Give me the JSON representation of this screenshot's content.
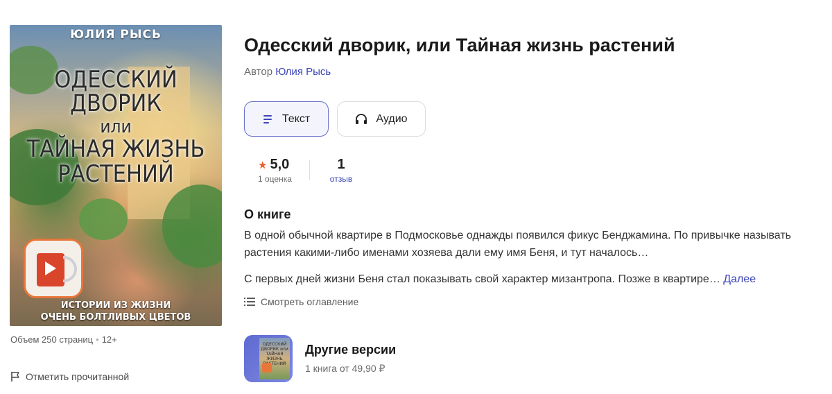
{
  "cover": {
    "author": "ЮЛИЯ РЫСЬ",
    "title_lines": [
      "ОДЕССКИЙ ДВОРИК",
      "или",
      "ТАЙНАЯ ЖИЗНЬ",
      "РАСТЕНИЙ"
    ],
    "bottom_lines": [
      "ИСТОРИИ ИЗ ЖИЗНИ",
      "ОЧЕНЬ БОЛТЛИВЫХ ЦВЕТОВ"
    ],
    "badge_icon": "audiobook-icon"
  },
  "meta": {
    "pages": "Объем 250 страниц",
    "age": "12+"
  },
  "mark_read_label": "Отметить прочитанной",
  "book": {
    "title": "Одесский дворик, или Тайная жизнь растений",
    "author_prefix": "Автор",
    "author_name": "Юлия Рысь"
  },
  "formats": {
    "text_label": "Текст",
    "audio_label": "Аудио",
    "selected": "Текст"
  },
  "rating": {
    "value": "5,0",
    "count_label": "1 оценка"
  },
  "reviews": {
    "value": "1",
    "label": "отзыв"
  },
  "about": {
    "heading": "О книге",
    "paragraph1": "В одной обычной квартире в Подмосковье однажды появился фикус Бенджамина. По привычке называть растения какими-либо именами хозяева дали ему имя Беня, и тут началось…",
    "paragraph2": "С первых дней жизни Беня стал показывать свой характер мизантропа. Позже в квартире…",
    "more_link": "Далее",
    "toc_label": "Смотреть оглавление"
  },
  "versions": {
    "title": "Другие версии",
    "subtitle": "1 книга от 49,90 ₽",
    "mini_cover_text": "ОДЕССКИЙ ДВОРИК или ТАЙНАЯ ЖИЗНЬ РАСТЕНИЙ"
  },
  "colors": {
    "accent": "#3b44b8",
    "star": "#f05a24",
    "selected_border": "#6a70c9"
  }
}
